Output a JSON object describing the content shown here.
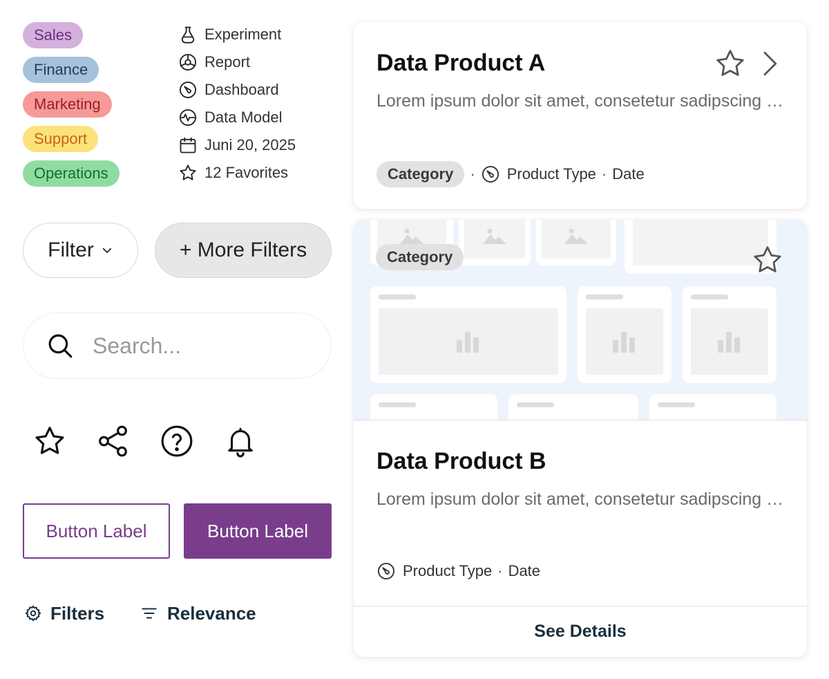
{
  "tags": [
    {
      "label": "Sales",
      "bg": "#d4b0dd",
      "fg": "#6b2f80"
    },
    {
      "label": "Finance",
      "bg": "#a6c2da",
      "fg": "#1d3e5b"
    },
    {
      "label": "Marketing",
      "bg": "#f59999",
      "fg": "#a01e22"
    },
    {
      "label": "Support",
      "bg": "#fbe27a",
      "fg": "#c8660f"
    },
    {
      "label": "Operations",
      "bg": "#8fdca0",
      "fg": "#1a6a2c"
    }
  ],
  "meta": {
    "experiment": "Experiment",
    "report": "Report",
    "dashboard": "Dashboard",
    "data_model": "Data Model",
    "date": "Juni 20, 2025",
    "favorites": "12 Favorites"
  },
  "filters": {
    "filter_label": "Filter",
    "more_label": "+ More Filters"
  },
  "search": {
    "placeholder": "Search..."
  },
  "icons": [
    "star-icon",
    "share-icon",
    "help-icon",
    "bell-icon"
  ],
  "buttons": {
    "outline_label": "Button Label",
    "solid_label": "Button Label",
    "accent": "#7a3d8c"
  },
  "links": {
    "filters": "Filters",
    "relevance": "Relevance"
  },
  "card_a": {
    "title": "Data Product A",
    "description": "Lorem ipsum dolor sit amet, consetetur sadipscing elitr",
    "category": "Category",
    "product_type": "Product Type",
    "date": "Date",
    "separator": "·"
  },
  "card_b": {
    "category": "Category",
    "title": "Data Product B",
    "description": "Lorem ipsum dolor sit amet, consetetur sadipscing elitr",
    "product_type": "Product Type",
    "date": "Date",
    "separator": "·",
    "cta": "See Details"
  }
}
